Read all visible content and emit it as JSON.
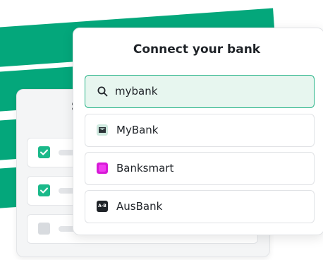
{
  "colors": {
    "brand_green": "#04a77b",
    "check_green": "#1bb98a",
    "search_border": "#2bb58a",
    "search_bg": "#e7f6ef",
    "banksmart_magenta": "#d71ad7"
  },
  "background_card": {
    "title_fragment": "S",
    "rows": [
      {
        "checked": true
      },
      {
        "checked": true
      },
      {
        "checked": false
      }
    ]
  },
  "dialog": {
    "title": "Connect your bank",
    "search": {
      "icon": "search-icon",
      "value": "mybank"
    },
    "banks": [
      {
        "name": "MyBank",
        "logo": "mybank-logo-icon"
      },
      {
        "name": "Banksmart",
        "logo": "banksmart-logo-icon"
      },
      {
        "name": "AusBank",
        "logo": "ausbank-logo-icon",
        "logo_text": "A-B"
      }
    ]
  }
}
